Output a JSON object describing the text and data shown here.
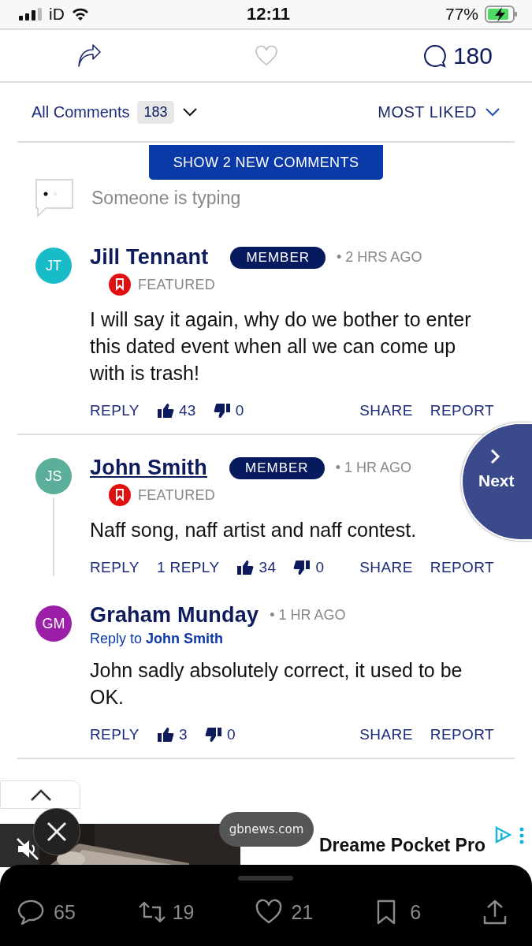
{
  "status_bar": {
    "carrier": "iD",
    "time": "12:11",
    "battery": "77%"
  },
  "action_bar": {
    "liked": false,
    "comment_count": "180"
  },
  "filter": {
    "label": "All Comments",
    "count": "183",
    "sort": "MOST LIKED"
  },
  "new_comments_button": "SHOW 2 NEW COMMENTS",
  "typing": "Someone is typing",
  "comments": [
    {
      "initials": "JT",
      "color": "#17bcc8",
      "author": "Jill Tennant",
      "linked": false,
      "badge": "MEMBER",
      "time": "• 2 HRS AGO",
      "featured": "FEATURED",
      "text": "I will say it again, why do we bother to enter this dated event when all we can come up with is trash!",
      "reply": "REPLY",
      "likes": "43",
      "dislikes": "0",
      "share": "SHARE",
      "report": "REPORT"
    },
    {
      "initials": "JS",
      "color": "#5aae9a",
      "author": "John Smith",
      "linked": true,
      "badge": "MEMBER",
      "time": "• 1 HR AGO",
      "featured": "FEATURED",
      "text": "Naff song, naff artist and naff contest.",
      "reply": "REPLY",
      "replies": "1 REPLY",
      "likes": "34",
      "dislikes": "0",
      "share": "SHARE",
      "report": "REPORT",
      "children": [
        {
          "initials": "GM",
          "color": "#9b1fa8",
          "author": "Graham Munday",
          "linked": false,
          "time": "• 1 HR AGO",
          "reply_to_label": "Reply to",
          "reply_to": "John Smith",
          "text": "John sadly absolutely correct, it used to be OK.",
          "reply": "REPLY",
          "likes": "3",
          "dislikes": "0",
          "share": "SHARE",
          "report": "REPORT"
        }
      ]
    }
  ],
  "next_button": "Next",
  "ad": {
    "domain": "gbnews.com",
    "title": "Dreame Pocket Pro"
  },
  "tweet_bar": {
    "replies": "65",
    "retweets": "19",
    "likes": "21",
    "bookmarks": "6"
  }
}
